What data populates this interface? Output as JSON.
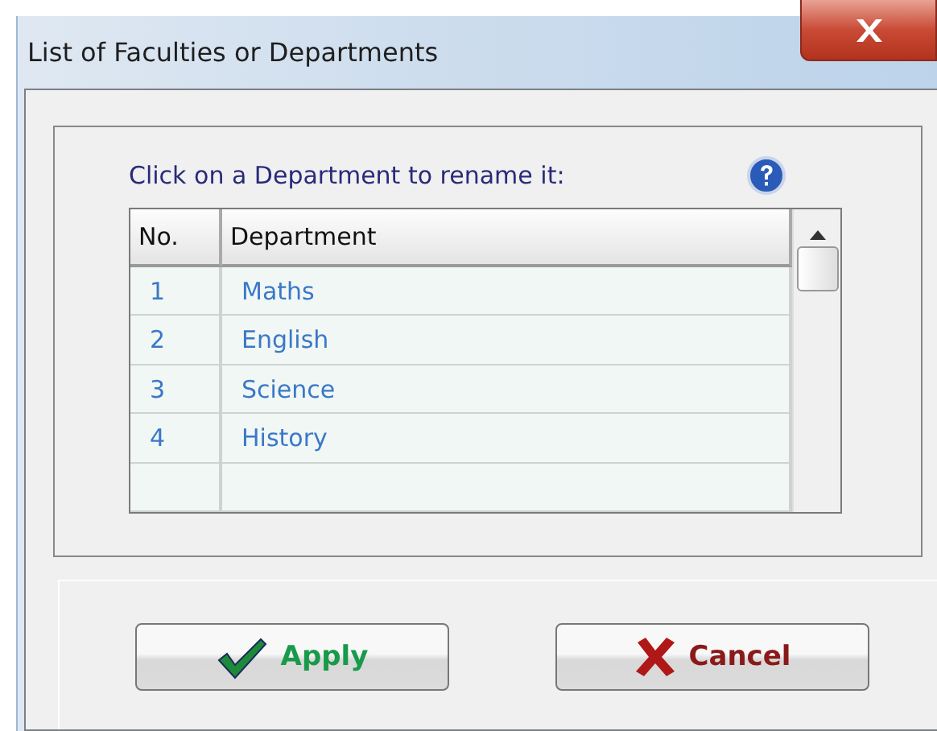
{
  "window": {
    "title": "List of Faculties or Departments"
  },
  "instruction": "Click on a Department to rename it:",
  "table": {
    "columns": [
      "No.",
      "Department"
    ],
    "rows": [
      {
        "no": "1",
        "department": "Maths"
      },
      {
        "no": "2",
        "department": "English"
      },
      {
        "no": "3",
        "department": "Science"
      },
      {
        "no": "4",
        "department": "History"
      }
    ]
  },
  "buttons": [
    {
      "kind": "apply",
      "label": "Apply"
    },
    {
      "kind": "cancel",
      "label": "Cancel"
    }
  ]
}
